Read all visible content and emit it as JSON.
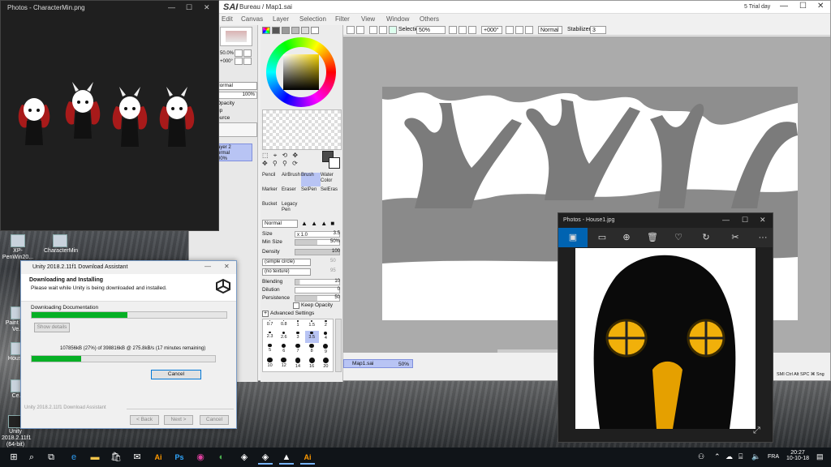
{
  "desktop": {
    "icons": [
      {
        "label": "XP-PenWin20..."
      },
      {
        "label": "CharacterMin"
      },
      {
        "label": "Paint Tool Ve..."
      },
      {
        "label": "House1"
      },
      {
        "label": "Ce..."
      },
      {
        "label": "Unity 2018.2.11f1 (64-bit)"
      }
    ]
  },
  "photos_char": {
    "title": "Photos - CharacterMin.png",
    "minimize": "—",
    "maximize": "☐",
    "close": "✕"
  },
  "sai": {
    "logo": "SAI",
    "title": "Bureau / Map1.sai",
    "trial": "5 Trial day",
    "menu": [
      "Canvas",
      "Layer",
      "Selection",
      "Filter",
      "View",
      "Window",
      "Others"
    ],
    "menu_first_partial": "Edit",
    "toolbar": {
      "selection_label": "Selection",
      "zoom": "50%",
      "rotation": "+000°",
      "blend_mode": "Normal",
      "stabilizer_label": "Stabilizer",
      "stabilizer_value": "3"
    },
    "left_panel": {
      "zoom": "50.0%",
      "angle": "+000°",
      "mode_label": "Normal",
      "opacity_label": "Opacity",
      "opacity_value": "100%",
      "clipping_label": "up",
      "source_label": "ource",
      "layer_name": "ayer 2",
      "layer_mode": "ormal",
      "layer_opacity": "00%"
    },
    "tools": [
      {
        "name": "Pencil"
      },
      {
        "name": "AirBrush"
      },
      {
        "name": "Brush"
      },
      {
        "name": "Water Color"
      },
      {
        "name": "Marker"
      },
      {
        "name": "Eraser"
      },
      {
        "name": "SelPen"
      },
      {
        "name": "SelEras"
      },
      {
        "name": "Bucket"
      },
      {
        "name": "Legacy Pen"
      }
    ],
    "brush_mode": "Normal",
    "size_label": "Size",
    "size_mult": "x 1.0",
    "size_value": "3.5",
    "min_size_label": "Min Size",
    "min_size_value": "50%",
    "density_label": "Density",
    "density_value": "100",
    "shape_option": "(simple circle)",
    "shape_value": "50",
    "texture_option": "(no texture)",
    "texture_value": "95",
    "blending_label": "Blending",
    "blending_value": "10",
    "dilution_label": "Dilution",
    "dilution_value": "0",
    "persistence_label": "Persistence",
    "persistence_value": "50",
    "keep_opacity_label": "Keep Opacity",
    "advanced_label": "Advanced Settings",
    "brush_sizes": [
      "0.7",
      "0.8",
      "1",
      "1.5",
      "2",
      "2.3",
      "2.6",
      "3",
      "3.5",
      "4",
      "5",
      "6",
      "7",
      "8",
      "9",
      "10",
      "12",
      "14",
      "16",
      "20"
    ],
    "document_tab": "Map1.sai",
    "document_zoom": "50%",
    "status_right": "SMI Ctrl Alt SPC ⌘ Sng"
  },
  "unity": {
    "title": "Unity 2018.2.11f1 Download Assistant",
    "heading": "Downloading and Installing",
    "subheading": "Please wait while Unity is being downloaded and installed.",
    "task_label": "Downloading Documentation",
    "progress1": 0.49,
    "show_details": "Show details",
    "progress_text": "107856kB (27%) of 398816kB @ 275.8kB/s (17 minutes remaining)",
    "progress2": 0.27,
    "cancel_main": "Cancel",
    "footer_label": "Unity 2018.2.11f1 Download Assistant",
    "back": "< Back",
    "next": "Next >",
    "cancel_footer": "Cancel"
  },
  "photos_house": {
    "title": "Photos - House1.jpg",
    "more": "···"
  },
  "taskbar": {
    "language": "FRA",
    "time": "20:27",
    "date": "10-10-18"
  },
  "colors": {
    "sai_accent": "#b8c4f4",
    "progress_green": "#06b025",
    "photos_blue": "#0063b1",
    "taskbar": "#101418"
  }
}
